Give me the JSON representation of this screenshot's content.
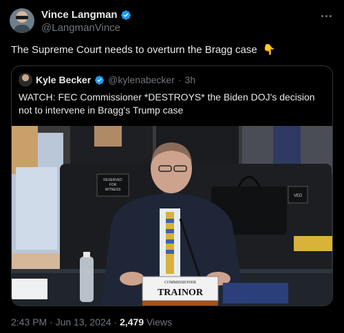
{
  "author": {
    "display_name": "Vince Langman",
    "handle": "@LangmanVince",
    "avatar_icon": "profile-photo",
    "verified_icon": "verified-badge-icon"
  },
  "tweet": {
    "text": "The Supreme Court needs to overturn the Bragg case",
    "emoji": "👇"
  },
  "quote": {
    "display_name": "Kyle Becker",
    "handle": "@kylenabecker",
    "separator": "·",
    "age": "3h",
    "text": "WATCH: FEC Commissioner *DESTROYS* the Biden DOJ's decision not to intervene in Bragg's Trump case"
  },
  "video": {
    "sign_reserved_line1": "RESERVED",
    "sign_reserved_line2": "FOR",
    "sign_reserved_line3": "WITNESS",
    "sign_partial": "VED",
    "nameplate_title": "COMMISSIONER",
    "nameplate_name": "TRAINOR"
  },
  "meta": {
    "time": "2:43 PM",
    "separator1": "·",
    "date": "Jun 13, 2024",
    "separator2": "·",
    "views_count": "2,479",
    "views_label": "Views"
  },
  "colors": {
    "background": "#000000",
    "text_primary": "#e7e9ea",
    "text_secondary": "#71767b",
    "verified_blue": "#1d9bf0",
    "border": "#2f3336"
  }
}
